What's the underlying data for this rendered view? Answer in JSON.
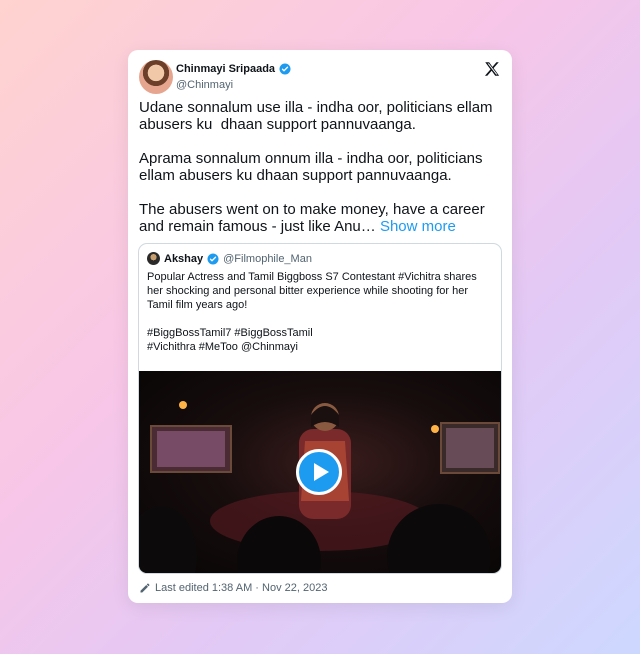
{
  "author": {
    "name": "Chinmayi Sripaada",
    "handle": "@Chinmayi"
  },
  "post": {
    "text": "Udane sonnalum use illa - indha oor, politicians ellam abusers ku  dhaan support pannuvaanga.\n\nAprama sonnalum onnum illa - indha oor, politicians ellam abusers ku dhaan support pannuvaanga.\n\nThe abusers went on to make money, have a career and remain famous - just like Anu… ",
    "show_more": "Show more"
  },
  "quote": {
    "name": "Akshay",
    "handle": "@Filmophile_Man",
    "text": "Popular Actress and Tamil Biggboss S7 Contestant #Vichitra shares her shocking and personal bitter experience while shooting for her Tamil film years ago!",
    "tags_line1": "#BiggBossTamil7 #BiggBossTamil",
    "tags_line2": "#Vichithra #MeToo @Chinmayi"
  },
  "footer": {
    "edited": "Last edited 1:38 AM · Nov 22, 2023"
  },
  "colors": {
    "accent": "#1d9bf0",
    "text": "#0f1419",
    "muted": "#536471"
  },
  "icons": [
    "verified-badge-icon",
    "x-logo-icon",
    "play-icon",
    "edit-pencil-icon"
  ]
}
